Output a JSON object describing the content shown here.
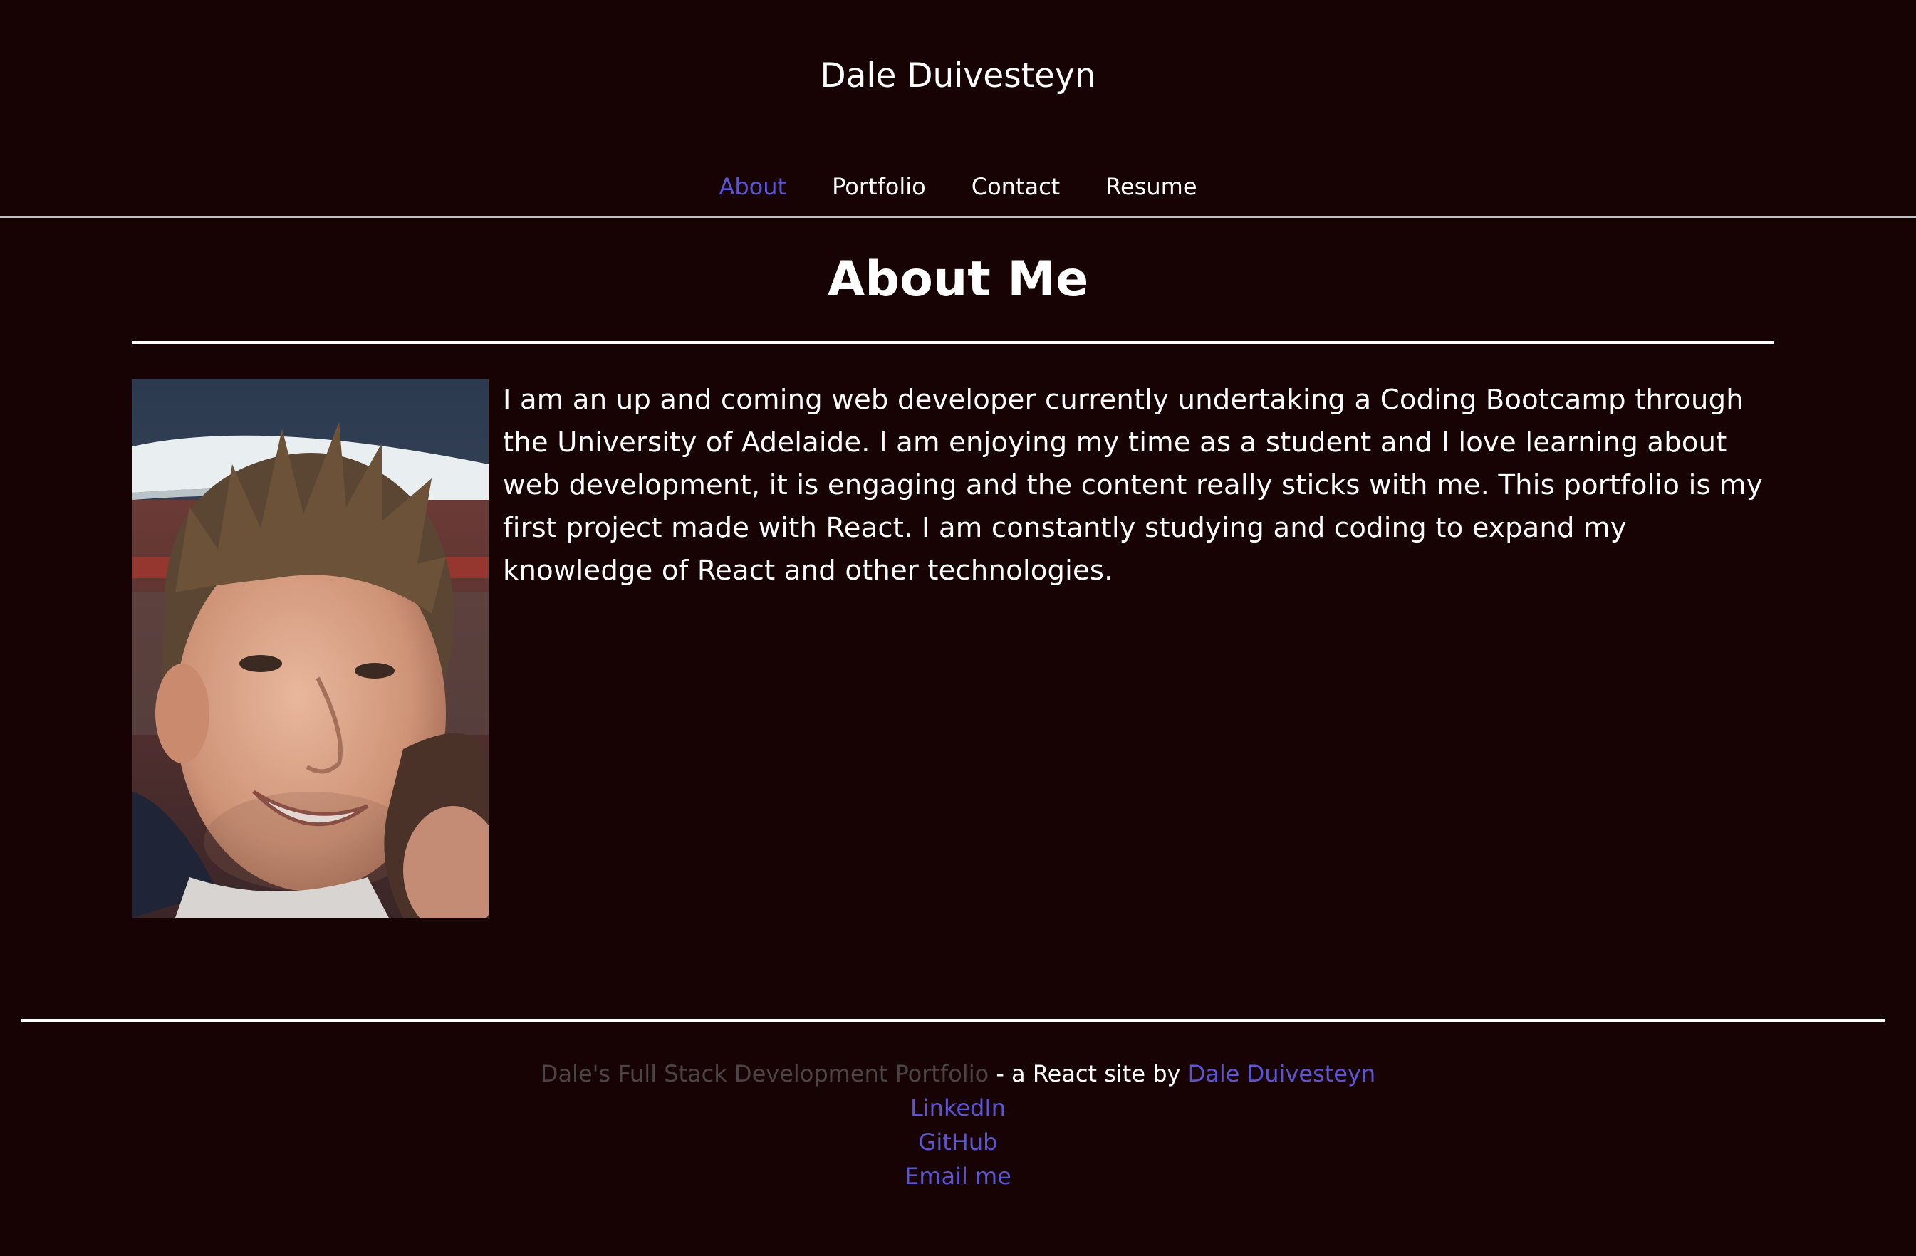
{
  "header": {
    "site_title": "Dale Duivesteyn",
    "nav": [
      {
        "label": "About",
        "active": true
      },
      {
        "label": "Portfolio",
        "active": false
      },
      {
        "label": "Contact",
        "active": false
      },
      {
        "label": "Resume",
        "active": false
      }
    ]
  },
  "main": {
    "heading": "About Me",
    "bio": "I am an up and coming web developer currently undertaking a Coding Bootcamp through the University of Adelaide. I am enjoying my time as a student and I love learning about web development, it is engaging and the content really sticks with me. This portfolio is my first project made with React. I am constantly studying and coding to expand my knowledge of React and other technologies."
  },
  "footer": {
    "portfolio_name": "Dale's Full Stack Development Portfolio",
    "byline_text": " - a React site by ",
    "author_link": "Dale Duivesteyn",
    "links": [
      "LinkedIn",
      "GitHub",
      "Email me"
    ]
  },
  "colors": {
    "background": "#170304",
    "accent": "#5b54d4",
    "muted": "#4a4444",
    "text": "#ffffff"
  }
}
